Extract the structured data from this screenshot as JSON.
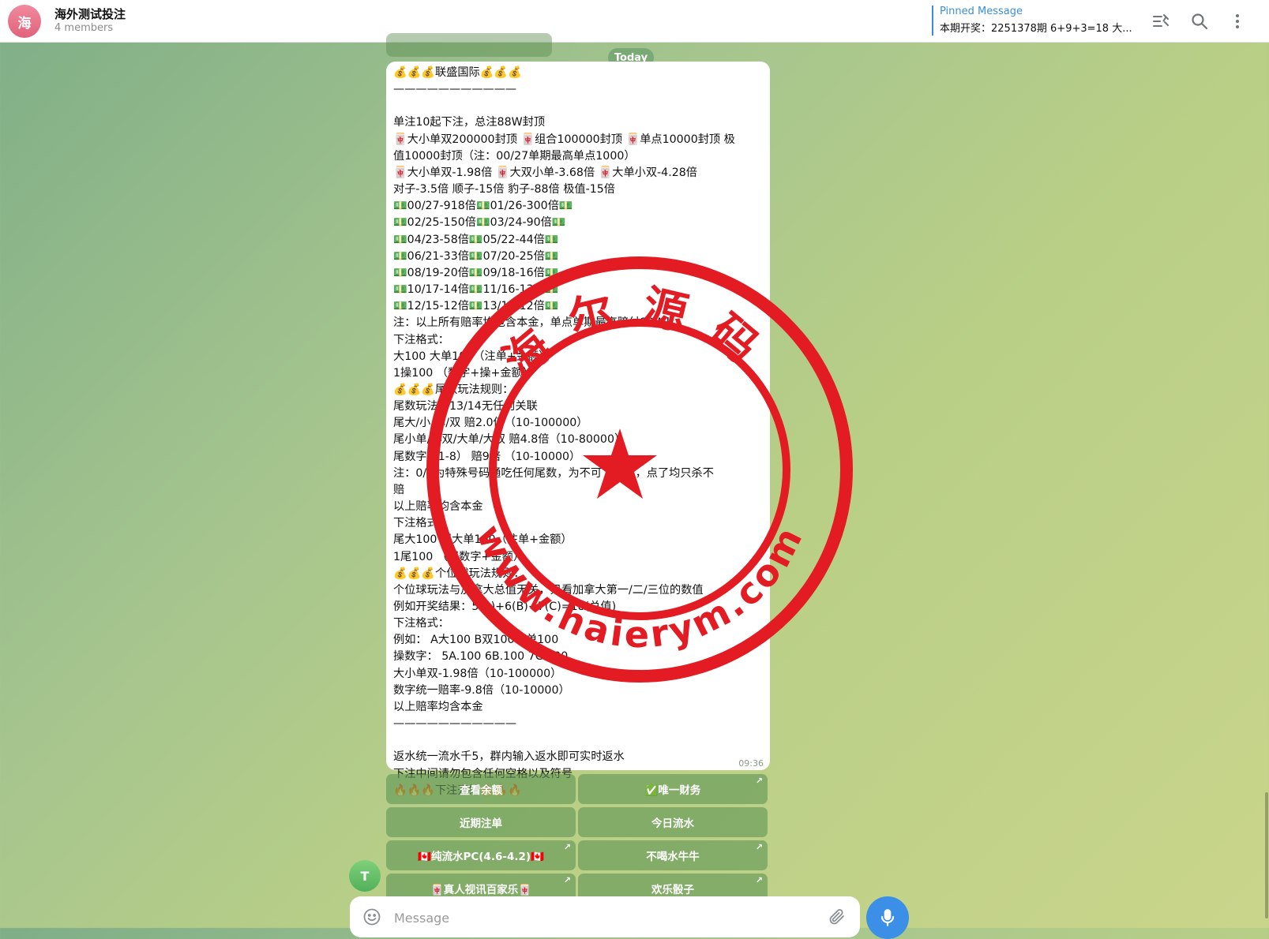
{
  "header": {
    "avatar_letter": "海",
    "title": "海外测试投注",
    "members": "4 members",
    "pinned_label": "Pinned Message",
    "pinned_text": "本期开奖：2251378期 6+9+3=18 大..."
  },
  "icons": {
    "pinned_list": "pinned-list-icon",
    "search": "search-icon",
    "more": "more-vertical-icon",
    "emoji": "emoji-icon",
    "attach": "paperclip-icon",
    "mic": "microphone-icon"
  },
  "date_badge": "Today",
  "message": {
    "lines": [
      "💰💰💰联盛国际💰💰💰",
      "———————————",
      "",
      "单注10起下注，总注88W封顶",
      "🀄大小单双200000封顶 🀄组合100000封顶 🀄单点10000封顶 极",
      "值10000封顶（注：00/27单期最高单点1000）",
      "🀄大小单双-1.98倍 🀄大双小单-3.68倍 🀄大单小双-4.28倍",
      "对子-3.5倍 顺子-15倍 豹子-88倍 极值-15倍",
      "💵00/27-918倍💵01/26-300倍💵",
      "💵02/25-150倍💵03/24-90倍💵",
      "💵04/23-58倍💵05/22-44倍💵",
      "💵06/21-33倍💵07/20-25倍💵",
      "💵08/19-20倍💵09/18-16倍💵",
      "💵10/17-14倍💵11/16-13倍💵",
      "💵12/15-12倍💵13/14-12倍💵",
      "注：以上所有赔率均包含本金，单点单期最高赔付88W！",
      "下注格式：",
      "大100 大单100（注单+金额）",
      "1操100 （数字+操+金额）",
      "💰💰💰尾数玩法规则：",
      "尾数玩法与13/14无任何关联",
      "尾大/小/单/双  赔2.0倍（10-100000）",
      "尾小单/小双/大单/大双  赔4.8倍（10-80000）",
      "尾数字（1-8）   赔9倍 （10-10000）",
      "注：0/9为特殊号码通吃任何尾数，为不可下注数，点了均只杀不",
      "赔",
      "以上赔率均含本金",
      "下注格式：",
      "尾大100 尾大单100（注单+金额）",
      "1尾100 （尾数字+金额）",
      "💰💰💰个位球玩法规则：",
      "个位球玩法与加拿大总值无关，只看加拿大第一/二/三位的数值",
      "例如开奖结果：5(A)+6(B)+7(C)=18(总值)",
      "下注格式：",
      "例如：   A大100 B双100  C单100",
      "操数字：  5A.100  6B.100   7C.100",
      "大小单双-1.98倍（10-100000）",
      "数字统一赔率-9.8倍（10-10000）",
      "以上赔率均含本金",
      "———————————",
      "",
      "返水统一流水千5，群内输入返水即可实时返水",
      "下注中间请勿包含任何空格以及符号",
      "🔥🔥🔥下注开始🔥🔥🔥"
    ],
    "time": "09:36"
  },
  "keyboard": [
    {
      "label": "查看余额",
      "arrow": ""
    },
    {
      "label": "✅唯一财务",
      "arrow": "↗"
    },
    {
      "label": "近期注单",
      "arrow": ""
    },
    {
      "label": "今日流水",
      "arrow": ""
    },
    {
      "label": "🇨🇦纯流水PC(4.6-4.2)🇨🇦",
      "arrow": "↗"
    },
    {
      "label": "不喝水牛牛",
      "arrow": "↗"
    },
    {
      "label": "🀄真人视讯百家乐🀄",
      "arrow": "↗"
    },
    {
      "label": "欢乐骰子",
      "arrow": "↗"
    }
  ],
  "sender_avatar_letter": "T",
  "composer": {
    "placeholder": "Message"
  },
  "watermark": {
    "top_text": "海尔源码",
    "bottom_text": "www.haierym.com",
    "color": "#e31b23"
  }
}
